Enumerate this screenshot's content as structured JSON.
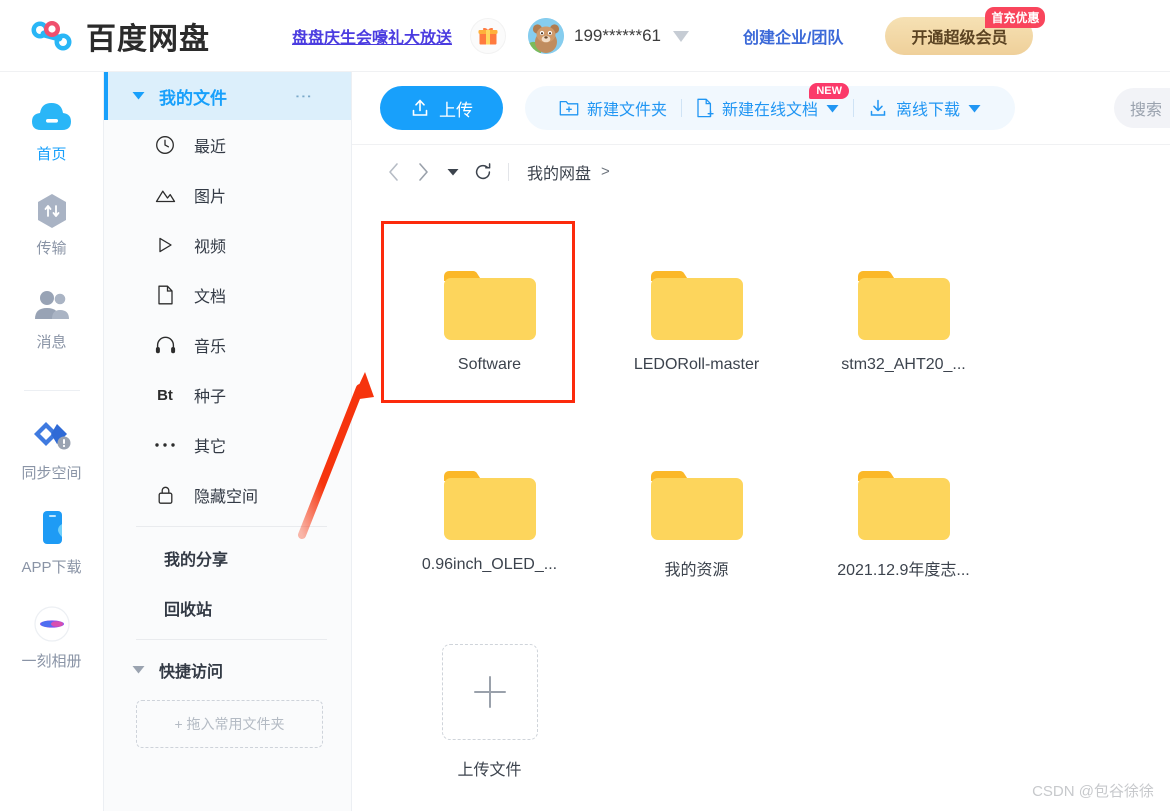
{
  "header": {
    "logo_text": "百度网盘",
    "promo_link": "盘盘庆生会嚎礼大放送",
    "gift_icon": "gift-icon",
    "user_id": "199******61",
    "biz_link": "创建企业/团队",
    "vip_button": "开通超级会员",
    "vip_badge": "首充优惠"
  },
  "rail": {
    "items": [
      {
        "label": "首页",
        "icon": "cloud-icon",
        "active": true
      },
      {
        "label": "传输",
        "icon": "transfer-icon",
        "active": false
      },
      {
        "label": "消息",
        "icon": "message-people-icon",
        "active": false
      },
      {
        "label": "同步空间",
        "icon": "sync-space-icon",
        "active": false
      },
      {
        "label": "APP下载",
        "icon": "phone-app-icon",
        "active": false
      },
      {
        "label": "一刻相册",
        "icon": "photo-album-icon",
        "active": false
      }
    ]
  },
  "tree": {
    "header": {
      "label": "我的文件",
      "caret": "chevron-down-icon",
      "more": "more-vertical-icon"
    },
    "items": [
      {
        "label": "最近",
        "icon": "clock-icon"
      },
      {
        "label": "图片",
        "icon": "image-icon"
      },
      {
        "label": "视频",
        "icon": "play-icon"
      },
      {
        "label": "文档",
        "icon": "document-icon"
      },
      {
        "label": "音乐",
        "icon": "headphone-icon"
      },
      {
        "label": "种子",
        "icon": "bt-icon"
      },
      {
        "label": "其它",
        "icon": "ellipsis-icon"
      },
      {
        "label": "隐藏空间",
        "icon": "lock-icon"
      }
    ],
    "plain_items": [
      {
        "label": "我的分享"
      },
      {
        "label": "回收站"
      }
    ],
    "quick_access": {
      "label": "快捷访问",
      "caret": "chevron-down-icon"
    },
    "drop_zone": "+ 拖入常用文件夹"
  },
  "toolbar": {
    "upload_label": "上传",
    "upload_icon": "upload-icon",
    "new_folder_label": "新建文件夹",
    "new_folder_icon": "folder-plus-icon",
    "new_doc_label": "新建在线文档",
    "new_doc_icon": "doc-plus-icon",
    "new_doc_badge": "NEW",
    "offline_label": "离线下载",
    "offline_icon": "download-icon",
    "search_placeholder": "搜索"
  },
  "breadcrumb": {
    "back_icon": "chevron-left-icon",
    "forward_icon": "chevron-right-icon",
    "history_icon": "caret-down-icon",
    "refresh_icon": "refresh-icon",
    "path": "我的网盘",
    "path_arrow": ">"
  },
  "files": [
    {
      "name": "Software",
      "type": "folder",
      "highlighted": true
    },
    {
      "name": "LEDORoll-master",
      "type": "folder",
      "highlighted": false
    },
    {
      "name": "stm32_AHT20_...",
      "type": "folder",
      "highlighted": false
    },
    {
      "name": "0.96inch_OLED_...",
      "type": "folder",
      "highlighted": false
    },
    {
      "name": "我的资源",
      "type": "folder",
      "highlighted": false
    },
    {
      "name": "2021.12.9年度志...",
      "type": "folder",
      "highlighted": false
    },
    {
      "name": "上传文件",
      "type": "add-tile",
      "highlighted": false
    }
  ],
  "annotations": {
    "highlight_color": "#fc2a0c",
    "arrow_color": "#f6340d",
    "target": "Software"
  },
  "watermark": "CSDN @包谷徐徐"
}
